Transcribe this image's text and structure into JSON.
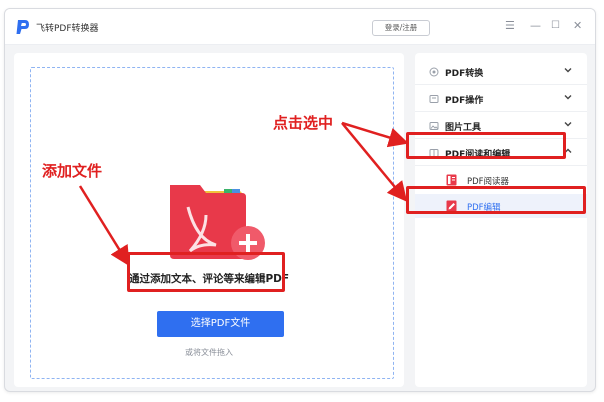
{
  "window": {
    "title": "飞转PDF转换器",
    "login_label": "登录/注册",
    "menu_glyph": "☰",
    "minimize_glyph": "—",
    "maximize_glyph": "☐",
    "close_glyph": "✕"
  },
  "main": {
    "upload_tip": "通过添加文本、评论等来编辑PDF",
    "select_button": "选择PDF文件",
    "drag_tip": "或将文件拖入"
  },
  "sidebar": {
    "categories": [
      {
        "label": "PDF转换",
        "icon": "convert-icon"
      },
      {
        "label": "PDF操作",
        "icon": "operation-icon"
      },
      {
        "label": "图片工具",
        "icon": "image-icon"
      },
      {
        "label": "PDF阅读和编辑",
        "icon": "read-edit-icon"
      }
    ],
    "sub_items": [
      {
        "label": "PDF阅读器",
        "icon": "reader-icon"
      },
      {
        "label": "PDF编辑",
        "icon": "edit-icon"
      }
    ]
  },
  "annotations": {
    "add_file": "添加文件",
    "click_select": "点击选中"
  },
  "colors": {
    "accent": "#2f6ff0",
    "annotation": "#e02020",
    "folder": "#e8394a",
    "badge": "#f05a6a"
  }
}
